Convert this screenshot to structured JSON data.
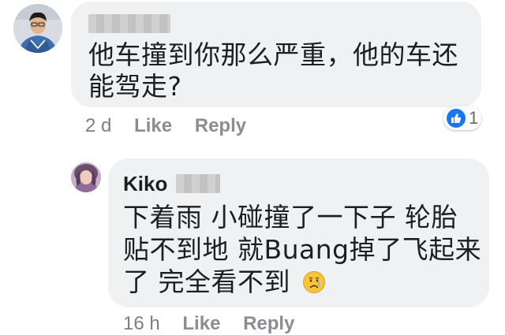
{
  "comment": {
    "text_line1": "他车撞到你那么严重，他的车还",
    "text_line2": "能驾走?",
    "time": "2 d",
    "like_label": "Like",
    "reply_label": "Reply",
    "reaction_count": "1",
    "reaction_icon": "thumbs-up-icon",
    "accent": "#1877f2"
  },
  "reply": {
    "author": "Kiko",
    "text_line1": "下着雨 小碰撞了一下子 轮胎",
    "text_line2": "贴不到地 就Buang掉了飞起来",
    "text_line3": "了 完全看不到",
    "emoji": "crying-face-icon",
    "time": "16 h",
    "like_label": "Like",
    "reply_label": "Reply"
  }
}
